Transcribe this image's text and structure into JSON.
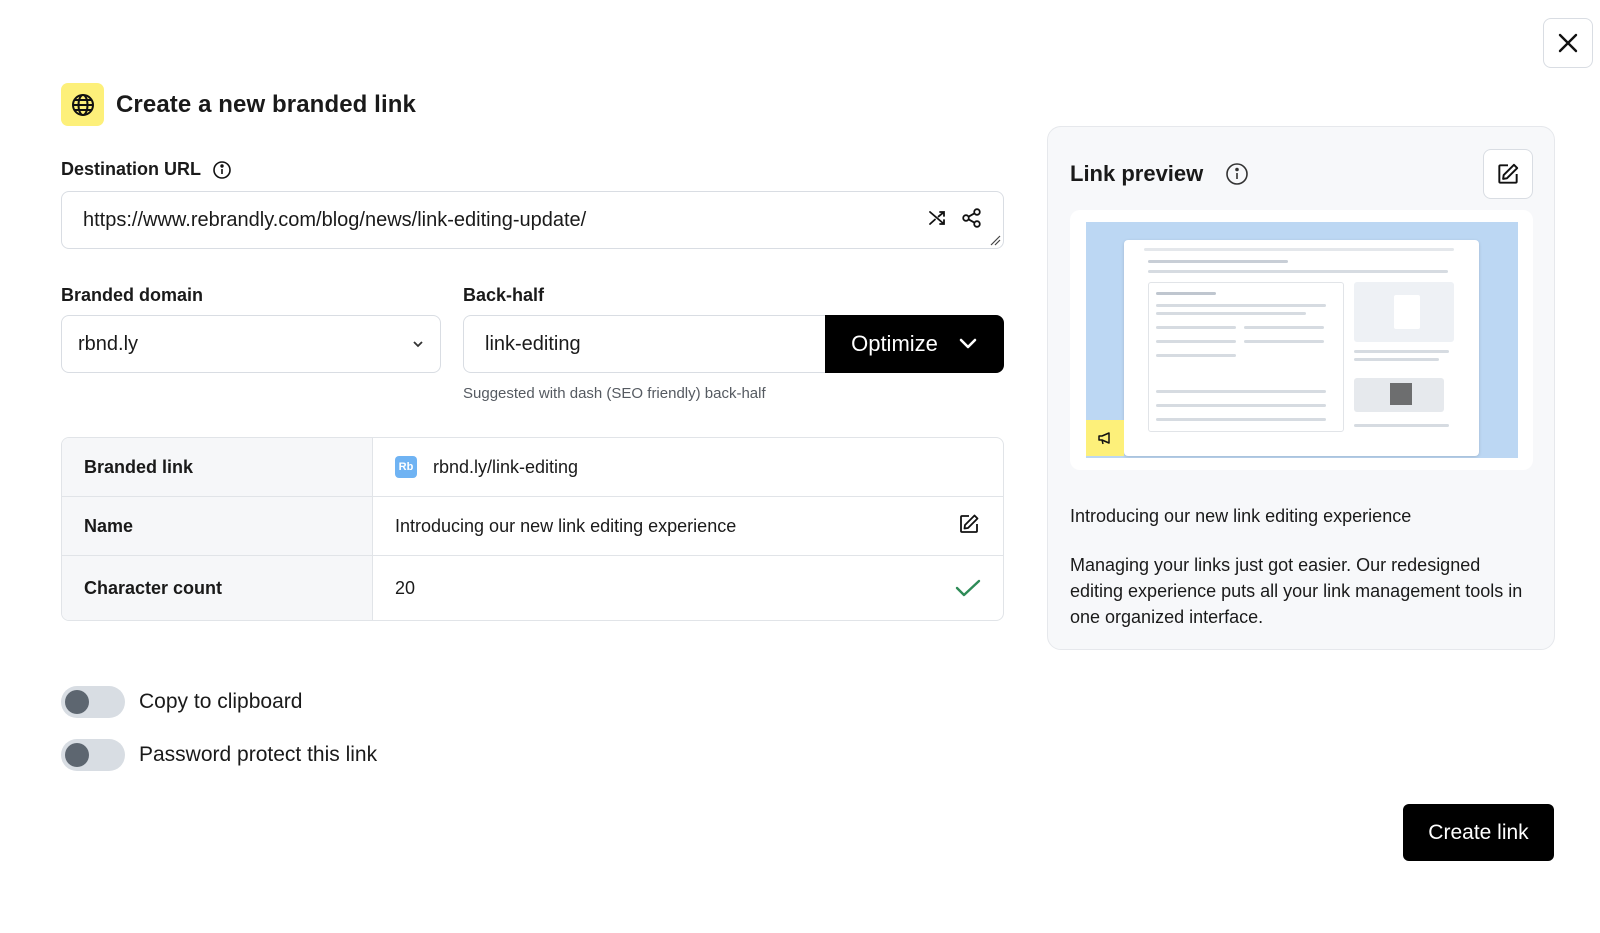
{
  "header": {
    "title": "Create a new branded link",
    "icon": "globe-icon"
  },
  "destination": {
    "label": "Destination URL",
    "value": "https://www.rebrandly.com/blog/news/link-editing-update/"
  },
  "domain": {
    "label": "Branded domain",
    "value": "rbnd.ly"
  },
  "backhalf": {
    "label": "Back-half",
    "value": "link-editing",
    "optimize_label": "Optimize",
    "hint": "Suggested with dash (SEO friendly) back-half"
  },
  "summary": {
    "branded_link_label": "Branded link",
    "branded_link_badge": "Rb",
    "branded_link_value": "rbnd.ly/link-editing",
    "name_label": "Name",
    "name_value": "Introducing our new link editing experience",
    "count_label": "Character count",
    "count_value": "20"
  },
  "toggles": {
    "clipboard": {
      "label": "Copy to clipboard",
      "on": false
    },
    "password": {
      "label": "Password protect this link",
      "on": false
    }
  },
  "actions": {
    "create_label": "Create link"
  },
  "preview": {
    "title": "Link preview",
    "name": "Introducing our new link editing experience",
    "description": "Managing your links just got easier. Our redesigned editing experience puts all your link management tools in one organized interface."
  },
  "colors": {
    "accent_yellow": "#fdf07a",
    "thumb_blue": "#bcd7f3",
    "check_green": "#2e8b57"
  }
}
